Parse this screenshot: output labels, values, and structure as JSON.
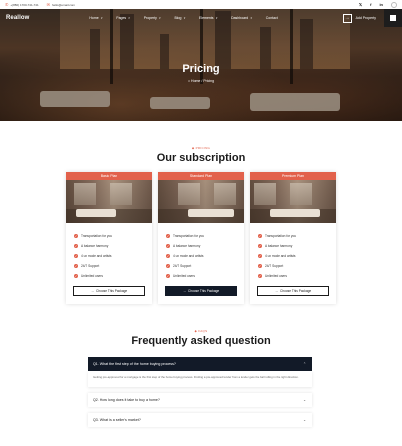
{
  "topbar": {
    "phone": "+(880) 1700-741-741",
    "email": "hello@email.com",
    "phone_icon": "phone-icon",
    "email_icon": "mail-icon",
    "social": [
      "x-icon",
      "facebook-icon",
      "linkedin-icon",
      "instagram-icon"
    ]
  },
  "header": {
    "logo": "Reallow",
    "menu": [
      {
        "label": "Home",
        "caret": true
      },
      {
        "label": "Pages",
        "caret": true
      },
      {
        "label": "Property",
        "caret": true
      },
      {
        "label": "Blog",
        "caret": true
      },
      {
        "label": "Elements",
        "caret": true
      },
      {
        "label": "Dashboard",
        "caret": true
      },
      {
        "label": "Contact",
        "caret": false
      }
    ],
    "add_property": "Add Property",
    "add_icon": "arrow-icon",
    "grid_icon": "grid-menu-icon"
  },
  "hero": {
    "title": "Pricing",
    "breadcrumb_home": "Home",
    "breadcrumb_sep": "/",
    "breadcrumb_current": "Pricing"
  },
  "subscription": {
    "eyebrow": "PRICING",
    "title": "Our subscription",
    "plans": [
      {
        "name": "Basic Plan",
        "features": [
          "Transportation for you",
          "A balance harmony",
          "4 ux mode and artists",
          "24/7 Support",
          "Unlimited users"
        ],
        "button": "Choose This Package",
        "highlighted": false
      },
      {
        "name": "Standard Plan",
        "features": [
          "Transportation for you",
          "A balance harmony",
          "4 ux mode and artists",
          "24/7 Support",
          "Unlimited users"
        ],
        "button": "Choose This Package",
        "highlighted": true
      },
      {
        "name": "Premium Plan",
        "features": [
          "Transportation for you",
          "A balance harmony",
          "4 ux mode and artists",
          "24/7 Support",
          "Unlimited users"
        ],
        "button": "Choose This Package",
        "highlighted": false
      }
    ]
  },
  "faq": {
    "eyebrow": "FAQS",
    "title": "Frequently asked question",
    "items": [
      {
        "q": "Q1. What the first step of the home buying process?",
        "a": "Getting pre-approved for a mortgage is the first step of the home buying process. Finding a pre-approved lender from a lender gets the ball rolling in the right direction.",
        "open": true
      },
      {
        "q": "Q2. How long does it take to buy a home?",
        "open": false
      },
      {
        "q": "Q3. What is a seller's market?",
        "open": false
      }
    ]
  },
  "colors": {
    "accent": "#e2614b",
    "dark": "#121a28"
  }
}
